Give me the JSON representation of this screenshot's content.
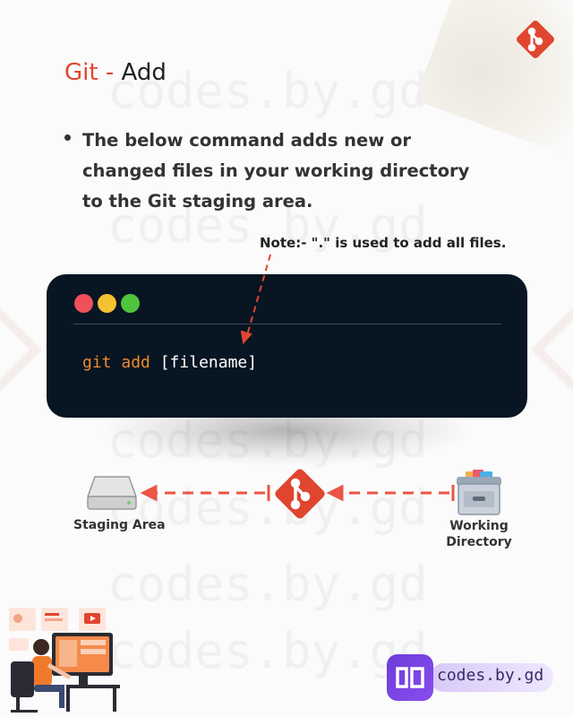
{
  "title": {
    "prefix": "Git - ",
    "main": "Add"
  },
  "bullet": {
    "text": "The below command adds new or changed files in your working directory to the Git staging area."
  },
  "note": {
    "text": "Note:- \".\" is used to add all files."
  },
  "terminal": {
    "code": {
      "cmd": "git",
      "sub": "add",
      "arg": "[filename]"
    }
  },
  "diagram": {
    "staging_label": "Staging Area",
    "working_label_line1": "Working",
    "working_label_line2": "Directory"
  },
  "watermark": "codes.by.gd",
  "brand": {
    "name": "codes.by.gd"
  },
  "colors": {
    "accent": "#e0462f",
    "terminal_bg": "#081522",
    "keyword": "#f08a2c",
    "brand_purple": "#7b45e8"
  },
  "icons": [
    "git-logo-icon",
    "hard-drive-icon",
    "file-cabinet-icon",
    "brand-logo-icon"
  ]
}
